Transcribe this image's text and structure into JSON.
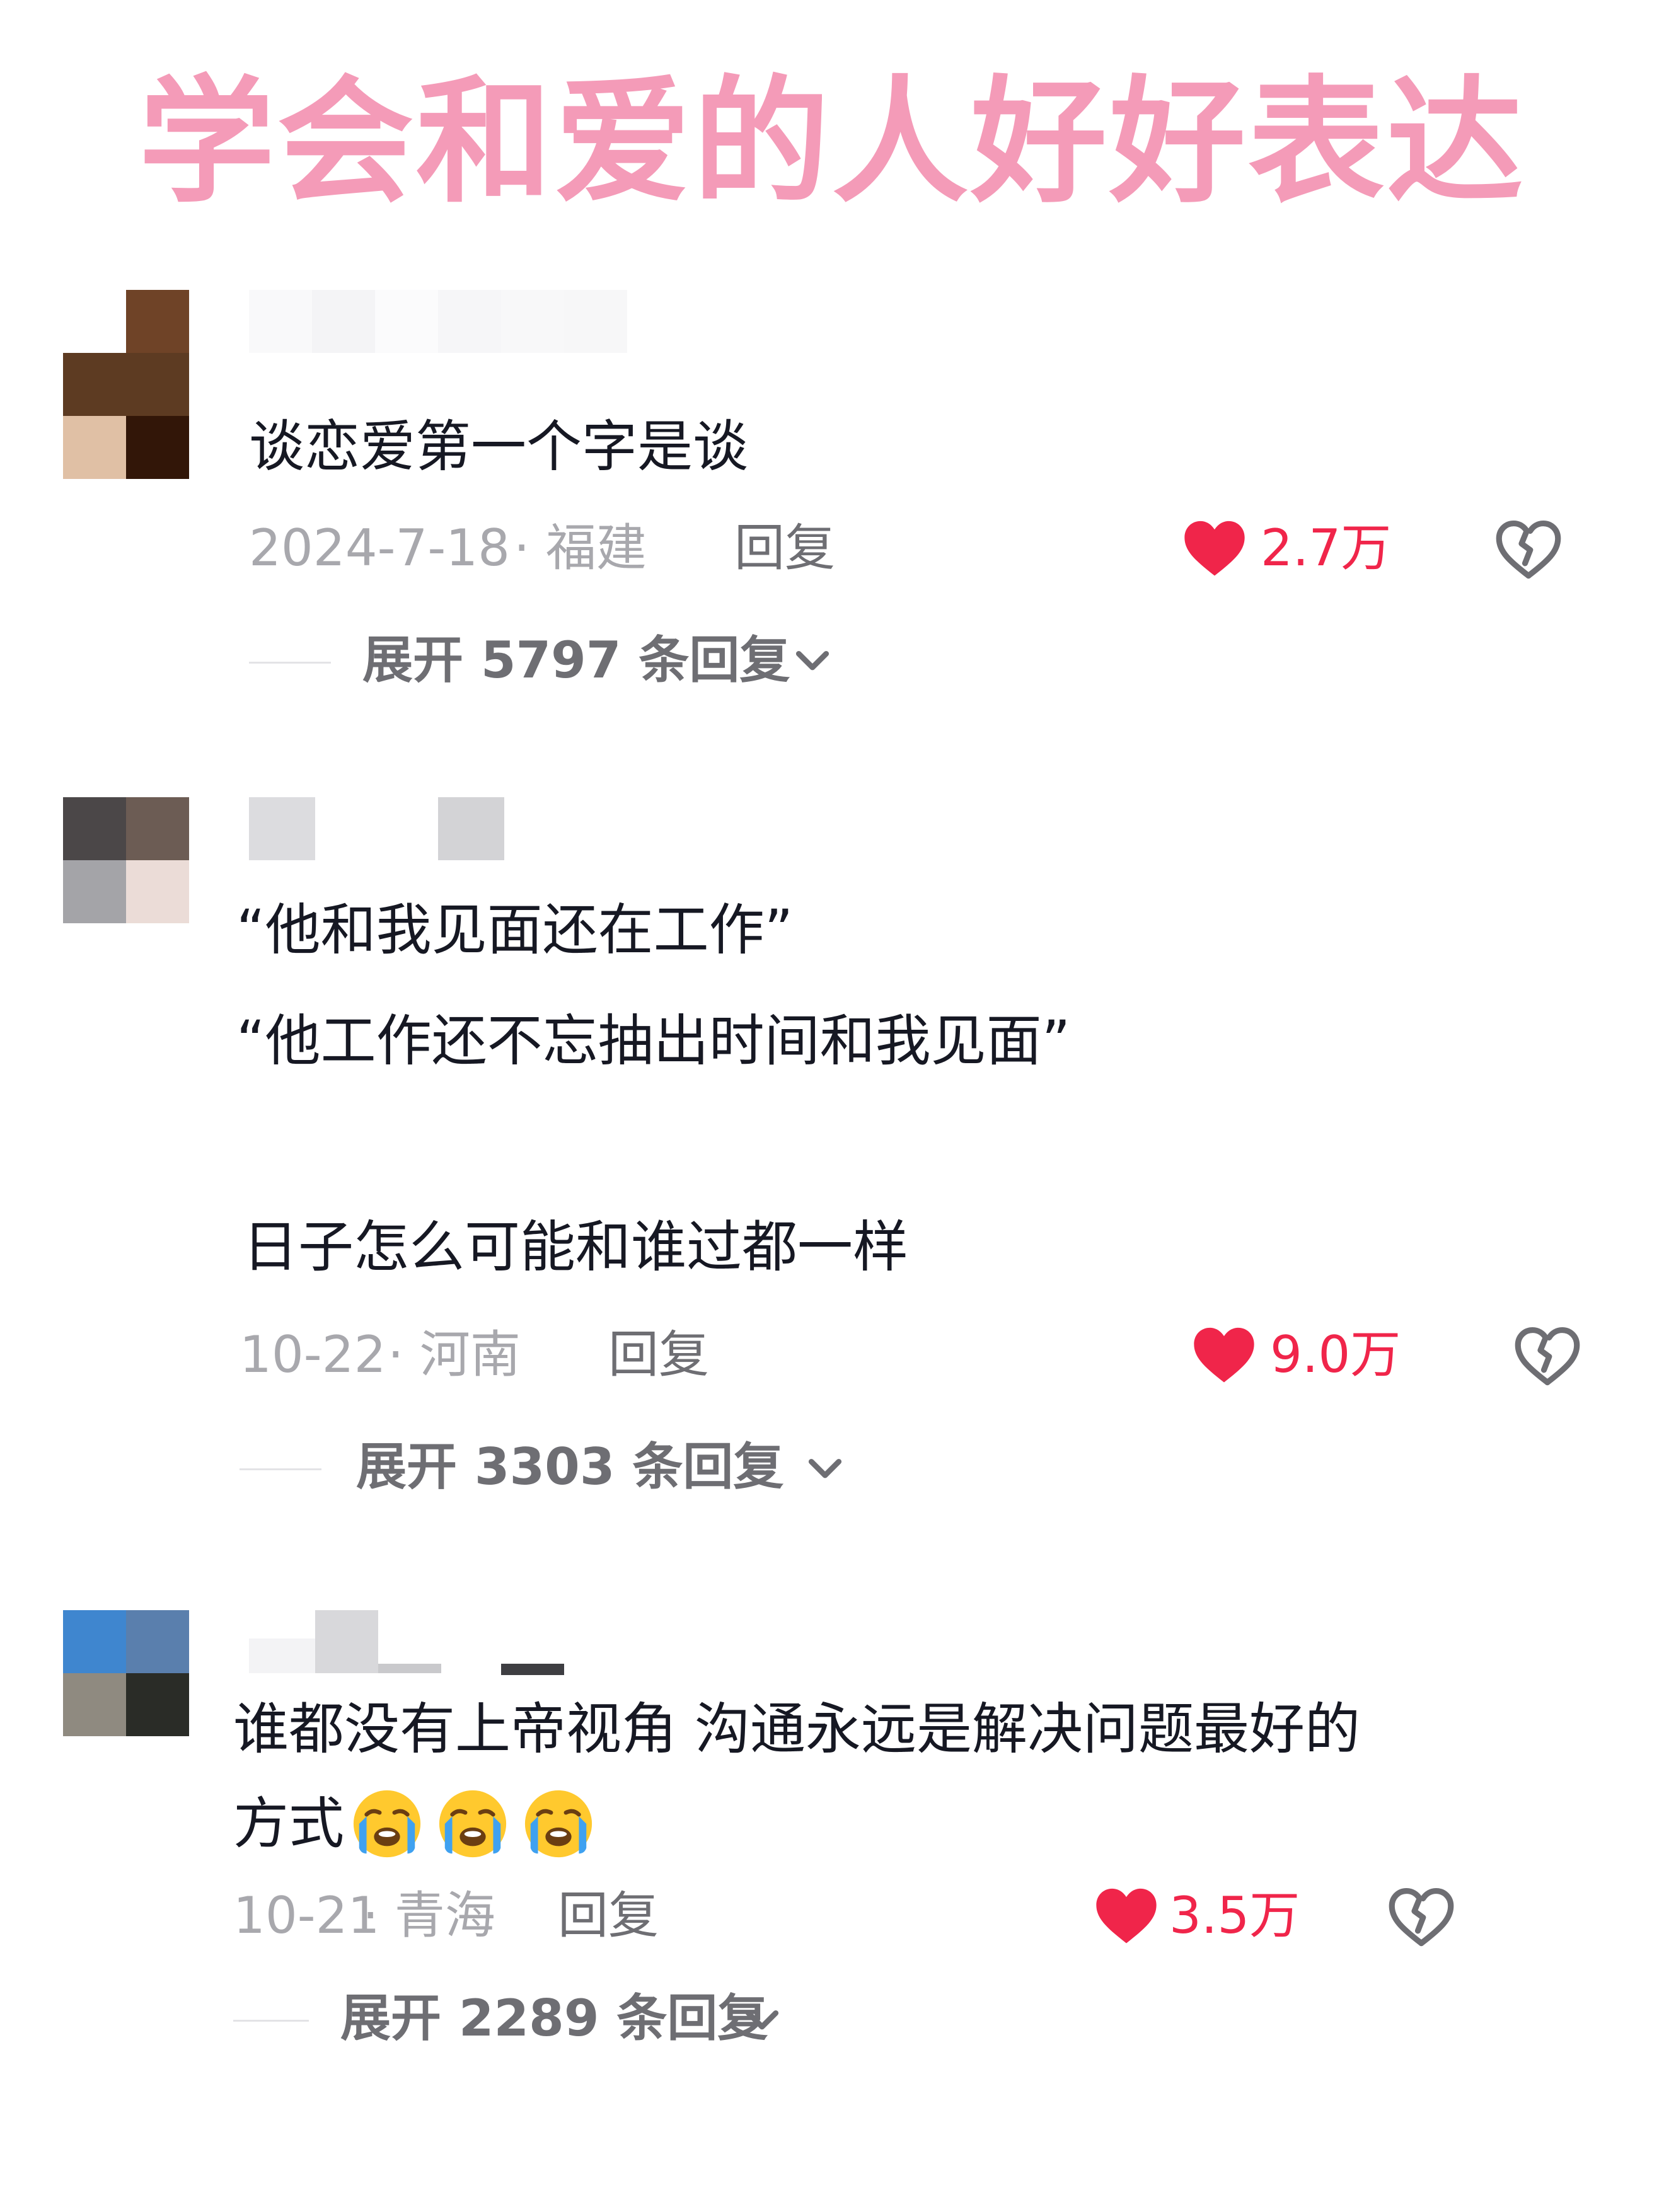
{
  "title": "学会和爱的人好好表达",
  "colors": {
    "title": "#f49bb8",
    "like": "#f0254a",
    "meta": "#a8a8ad",
    "secondary": "#6e6e73"
  },
  "comments": [
    {
      "avatar_colors": [
        "#ffffff",
        "#6f4327",
        "#6b4428",
        "#5d3b22",
        "#e0c0a5",
        "#321608"
      ],
      "lines": [
        "谈恋爱第一个字是谈"
      ],
      "date": "2024-7-18",
      "location": "· 福建",
      "reply_label": "回复",
      "likes": "2.7万",
      "expand_label": "展开 5797 条回复"
    },
    {
      "avatar_colors": [
        "#4b4748",
        "#6c5c54",
        "#a4a4a8",
        "#ebdcd7"
      ],
      "lines": [
        "“他和我见面还在工作”",
        "“他工作还不忘抽出时间和我见面”",
        "日子怎么可能和谁过都一样"
      ],
      "date": "10-22",
      "location": "· 河南",
      "reply_label": "回复",
      "likes": "9.0万",
      "expand_label": "展开 3303 条回复"
    },
    {
      "avatar_colors": [
        "#3f86cf",
        "#5a7fad",
        "#8f8a80",
        "#2a2c27"
      ],
      "lines": [
        "谁都没有上帝视角  沟通永远是解决问题最好的",
        "方式"
      ],
      "emoji": [
        "loudly-crying-face-icon",
        "loudly-crying-face-icon",
        "loudly-crying-face-icon"
      ],
      "date": "10-21",
      "location": "· 青海",
      "reply_label": "回复",
      "likes": "3.5万",
      "expand_label": "展开 2289 条回复"
    }
  ]
}
